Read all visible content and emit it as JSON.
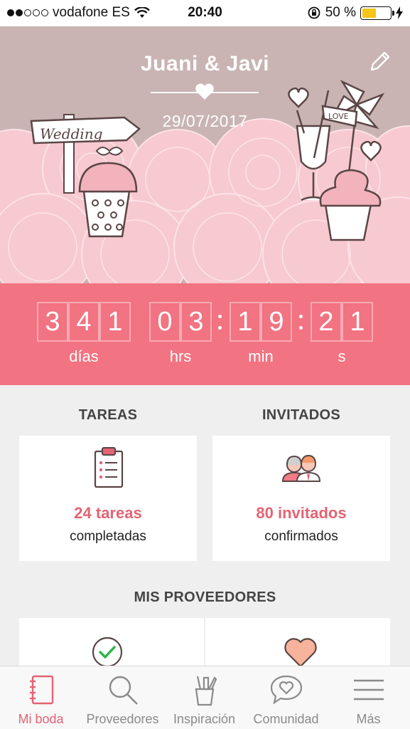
{
  "status_bar": {
    "carrier": "vodafone ES",
    "time": "20:40",
    "battery": "50 %",
    "battery_level": 0.5
  },
  "hero": {
    "couple": "Juani & Javi",
    "date": "29/07/2017",
    "sign_text": "Wedding",
    "flag_text": "LOVE"
  },
  "countdown": {
    "days": [
      "3",
      "4",
      "1"
    ],
    "hours": [
      "0",
      "3"
    ],
    "minutes": [
      "1",
      "9"
    ],
    "seconds": [
      "2",
      "1"
    ],
    "labels": {
      "days": "días",
      "hours": "hrs",
      "minutes": "min",
      "seconds": "s"
    }
  },
  "tasks": {
    "title": "TAREAS",
    "count": "24 tareas",
    "caption": "completadas"
  },
  "guests": {
    "title": "INVITADOS",
    "count": "80 invitados",
    "caption": "confirmados"
  },
  "vendors": {
    "title": "MIS PROVEEDORES"
  },
  "tabbar": {
    "items": [
      {
        "label": "Mi boda",
        "icon": "notebook-icon",
        "active": true
      },
      {
        "label": "Proveedores",
        "icon": "search-icon",
        "active": false
      },
      {
        "label": "Inspiración",
        "icon": "pencil-cup-icon",
        "active": false
      },
      {
        "label": "Comunidad",
        "icon": "heart-chat-icon",
        "active": false
      },
      {
        "label": "Más",
        "icon": "menu-icon",
        "active": false
      }
    ]
  },
  "colors": {
    "accent": "#f27381",
    "accent_text": "#e46374",
    "hero_bg": "#c9b3b3",
    "flower": "#f7c9d0"
  }
}
